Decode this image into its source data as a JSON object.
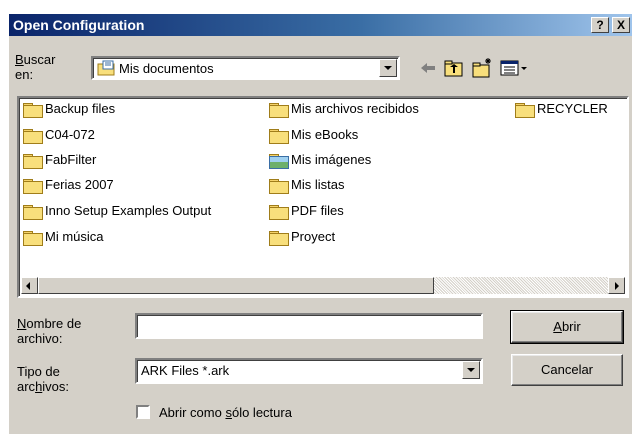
{
  "dialog": {
    "title": "Open Configuration",
    "help_button": "?",
    "close_button": "X"
  },
  "look_in": {
    "label_underlined": "B",
    "label_line1_rest": "uscar",
    "label_line2": "en:",
    "value": "Mis documentos",
    "icon": "my-documents-icon"
  },
  "toolbar": {
    "back_icon": "back-arrow-icon",
    "up_icon": "up-folder-icon",
    "new_folder_icon": "new-folder-icon",
    "view_menu_icon": "view-menu-icon"
  },
  "files": [
    {
      "name": "Backup files",
      "icon": "folder-icon"
    },
    {
      "name": "C04-072",
      "icon": "folder-icon"
    },
    {
      "name": "FabFilter",
      "icon": "folder-icon"
    },
    {
      "name": "Ferias 2007",
      "icon": "folder-icon"
    },
    {
      "name": "Inno Setup Examples Output",
      "icon": "folder-icon"
    },
    {
      "name": "Mi música",
      "icon": "folder-icon"
    },
    {
      "name": "Mis archivos recibidos",
      "icon": "folder-icon"
    },
    {
      "name": "Mis eBooks",
      "icon": "folder-icon"
    },
    {
      "name": "Mis imágenes",
      "icon": "pictures-folder-icon"
    },
    {
      "name": "Mis listas",
      "icon": "folder-icon"
    },
    {
      "name": "PDF files",
      "icon": "folder-icon"
    },
    {
      "name": "Proyect",
      "icon": "folder-icon"
    },
    {
      "name": "RECYCLER",
      "icon": "folder-icon"
    }
  ],
  "filename": {
    "label_underlined": "N",
    "label_line1_rest": "ombre de",
    "label_line2": "archivo:",
    "value": "",
    "open_button_underlined": "A",
    "open_button_rest": "brir"
  },
  "filetype": {
    "label_line1": "Tipo de",
    "label_line2_pre": "arc",
    "label_line2_underlined": "h",
    "label_line2_post": "ivos:",
    "value": "ARK Files *.ark",
    "cancel_button": "Cancelar"
  },
  "readonly": {
    "label_pre": "Abrir como ",
    "label_underlined": "s",
    "label_post": "ólo lectura",
    "checked": false
  }
}
